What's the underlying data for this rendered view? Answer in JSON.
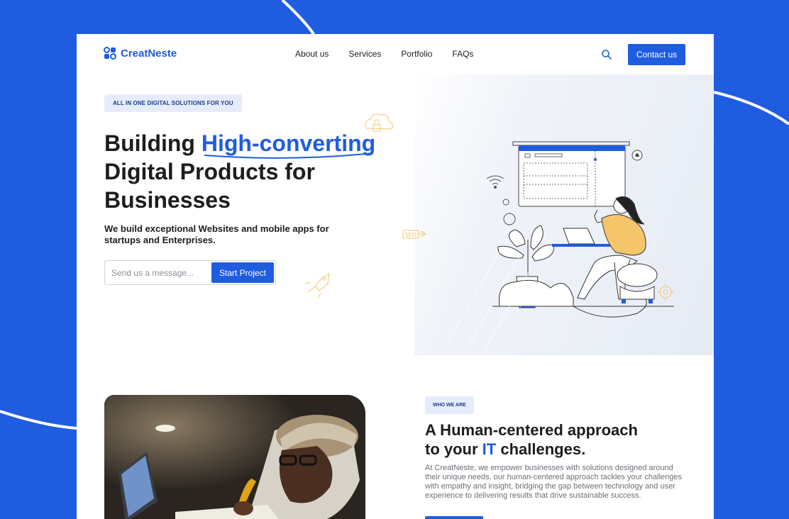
{
  "brand": {
    "name": "CreatNeste",
    "color": "#1f5ce0",
    "icon": "logo-icon"
  },
  "nav": {
    "links": [
      "About us",
      "Services",
      "Portfolio",
      "FAQs"
    ],
    "search_icon": "search-icon",
    "contact_label": "Contact us"
  },
  "hero": {
    "badge": "ALL IN ONE DIGITAL SOLUTIONS FOR YOU",
    "title_part1": "Building ",
    "title_highlight": "High-converting",
    "title_line2": "Digital Products for",
    "title_line3": "Businesses",
    "subtitle": "We build exceptional Websites and mobile apps for startups and Enterprises.",
    "input_placeholder": "Send us a message...",
    "cta_label": "Start Project",
    "seo_label": "SEO"
  },
  "about": {
    "badge": "WHO WE ARE",
    "title_line1": "A Human-centered approach",
    "title_line2_a": "to your ",
    "title_line2_it": "IT",
    "title_line2_b": " challenges.",
    "body": "At CreatNeste, we empower businesses with solutions designed around their unique needs, our human-centered approach tackles your challenges with empathy and insight, bridging the gap between technology and user experience to delivering results that drive sustainable success."
  },
  "colors": {
    "accent": "#1f5ce0",
    "background": "#1f5ce0",
    "badge_bg": "#e6ecfa",
    "illustration_yellow": "#f5c56b"
  }
}
